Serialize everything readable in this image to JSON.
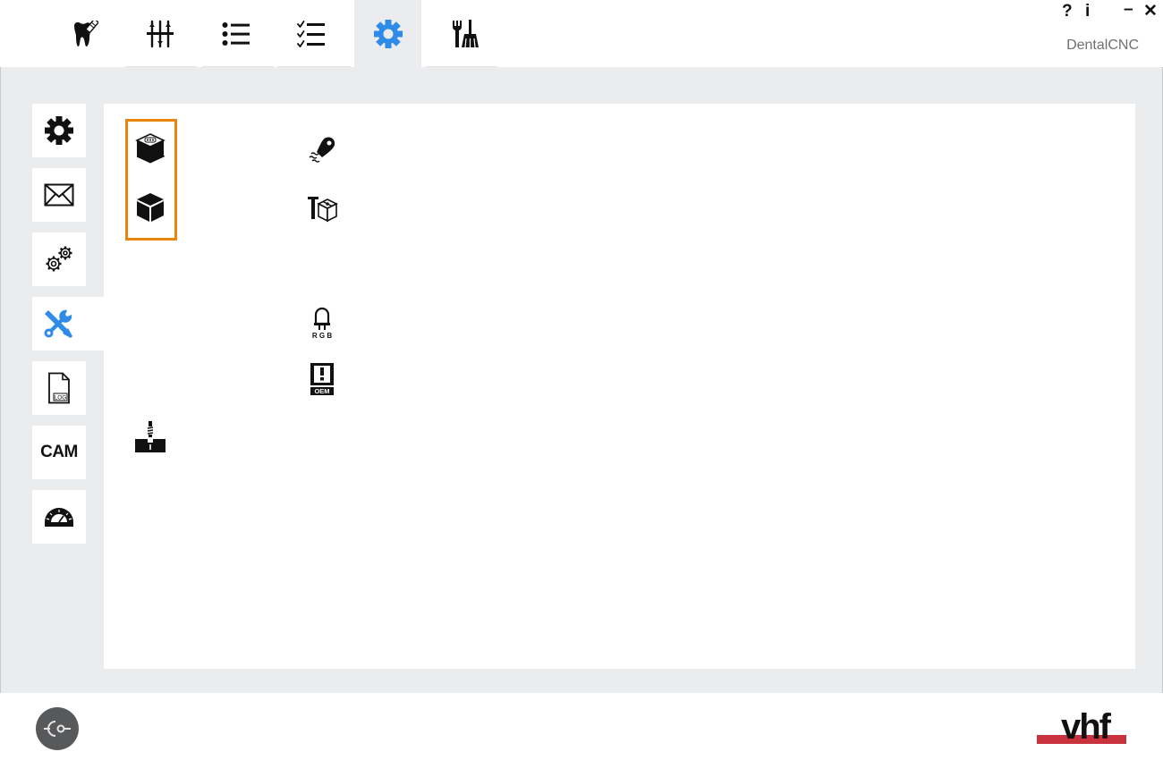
{
  "window": {
    "title": "DentalCNC",
    "help_label": "?",
    "info_label": "i",
    "minimize_label": "–",
    "close_label": "✕"
  },
  "top_tabs": [
    {
      "icon": "tooth-icon",
      "active": false
    },
    {
      "icon": "sliders-icon",
      "active": false
    },
    {
      "icon": "list-icon",
      "active": false
    },
    {
      "icon": "checklist-icon",
      "active": false
    },
    {
      "icon": "gear-icon",
      "active": true
    },
    {
      "icon": "tools-broom-icon",
      "active": false
    }
  ],
  "sidebar": {
    "items": [
      {
        "icon": "gear-icon",
        "active": false
      },
      {
        "icon": "envelope-icon",
        "active": false
      },
      {
        "icon": "gears-icon",
        "active": false
      },
      {
        "icon": "wrench-screwdriver-icon",
        "active": true
      },
      {
        "icon": "log-file-icon",
        "label": "LOG",
        "active": false
      },
      {
        "icon": "cam-icon",
        "label": "CAM",
        "active": false
      },
      {
        "icon": "protractor-icon",
        "active": false
      }
    ]
  },
  "panel": {
    "rgb_label": "R G B",
    "oem_label": "OEM",
    "highlight_color": "#e8850f"
  },
  "branding": {
    "logo_text": "vhf",
    "logo_bar_color": "#c8323c"
  },
  "colors": {
    "accent": "#2e8be8",
    "background": "#ebecee"
  }
}
